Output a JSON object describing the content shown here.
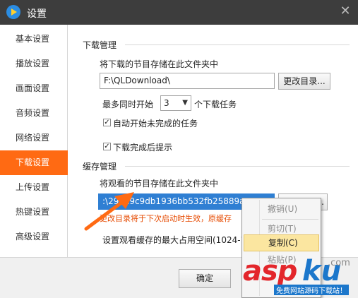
{
  "window": {
    "title": "设置",
    "close_glyph": "✕"
  },
  "sidebar": {
    "items": [
      {
        "label": "基本设置"
      },
      {
        "label": "播放设置"
      },
      {
        "label": "画面设置"
      },
      {
        "label": "音频设置"
      },
      {
        "label": "网络设置"
      },
      {
        "label": "下载设置",
        "active": true
      },
      {
        "label": "上传设置"
      },
      {
        "label": "热键设置"
      },
      {
        "label": "高级设置"
      }
    ]
  },
  "download": {
    "section_title": "下载管理",
    "folder_label": "将下载的节目存储在此文件夹中",
    "folder_value": "F:\\QLDownload\\",
    "change_button": "更改目录...",
    "concurrent_prefix": "最多同时开始",
    "concurrent_value": "3",
    "concurrent_suffix": "个下载任务",
    "auto_start_label": "自动开始未完成的任务",
    "auto_start_checked": true,
    "notify_label": "下载完成后提示",
    "notify_checked": true
  },
  "cache": {
    "section_title": "缓存管理",
    "folder_label": "将观看的节目存储在此文件夹中",
    "folder_value": ":\\29ba9c9db1936bb532fb25889a7",
    "change_button": "...",
    "warning": "更改目录将于下次启动时生效，原缓存",
    "max_label": "设置观看缓存的最大占用空间(1024-10"
  },
  "footer": {
    "ok_button": "确定"
  },
  "context_menu": {
    "items": [
      {
        "label": "撤销(U)",
        "disabled": true
      },
      {
        "label": "剪切(T)",
        "disabled": true
      },
      {
        "label": "复制(C)",
        "hover": true
      },
      {
        "label": "粘贴(P)",
        "disabled": true
      }
    ]
  },
  "watermark": {
    "asp": "asp",
    "ku": "ku",
    "com": ".com",
    "sub": "免费网站源码下载站！"
  },
  "colors": {
    "accent": "#ff6a13",
    "selection": "#2f7fd3",
    "titlebar": "#3d3d3d",
    "warning": "#e64a00",
    "arrow": "#ff6a13"
  }
}
